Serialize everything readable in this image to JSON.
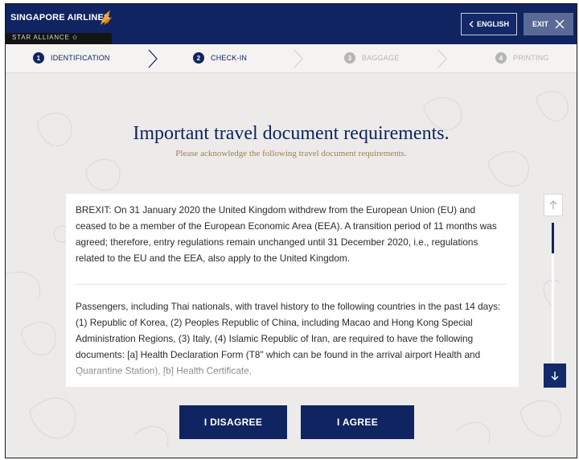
{
  "header": {
    "logo_text": "SINGAPORE AIRLINES",
    "alliance_text": "STAR ALLIANCE ✩",
    "language_button": "ENGLISH",
    "exit_button": "EXIT"
  },
  "steps": [
    {
      "number": "1",
      "label": "IDENTIFICATION",
      "state": "active"
    },
    {
      "number": "2",
      "label": "CHECK-IN",
      "state": "active"
    },
    {
      "number": "3",
      "label": "BAGGAGE",
      "state": "inactive"
    },
    {
      "number": "4",
      "label": "PRINTING",
      "state": "inactive"
    }
  ],
  "main": {
    "title": "Important travel document requirements.",
    "subtitle": "Please acknowledge the following travel document requirements.",
    "paragraphs": [
      "BREXIT: On 31 January 2020 the United Kingdom withdrew from the European Union (EU) and ceased to be a member of the European Economic Area (EEA). A transition period of 11 months was agreed; therefore, entry regulations remain unchanged until 31 December 2020, i.e., regulations related to the EU and the EEA, also apply to the United Kingdom.",
      "Passengers, including Thai nationals, with travel history to the following countries in the past 14 days: (1) Republic of Korea, (2) Peoples Republic of China, including Macao and Hong Kong Special Administration Regions, (3) Italy, (4) Islamic Republic of Iran, are required to have the following documents: [a] Health Declaration Form (T8\" which can be found in the arrival airport Health and Quarantine Station), [b] Health Certificate,"
    ]
  },
  "actions": {
    "disagree": "I DISAGREE",
    "agree": "I AGREE"
  },
  "colors": {
    "brand_navy": "#0f2460",
    "accent_gold": "#a08050",
    "inactive_grey": "#b5b5b5"
  },
  "icons": {
    "scroll_up": "arrow-up-icon",
    "scroll_down": "arrow-down-icon",
    "language": "chevron-left-icon",
    "exit": "close-icon"
  }
}
